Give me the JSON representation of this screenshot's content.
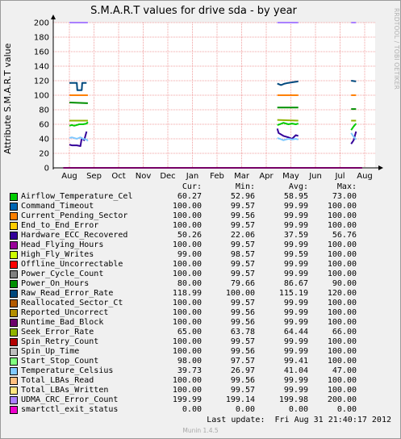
{
  "chart_data": {
    "type": "line",
    "title": "S.M.A.R.T values for drive sda - by year",
    "ylabel": "Attribute S.M.A.R.T value",
    "ylim": [
      0,
      200
    ],
    "yticks": [
      0,
      20,
      40,
      60,
      80,
      100,
      120,
      140,
      160,
      180,
      200
    ],
    "xticks": [
      "Aug",
      "Sep",
      "Oct",
      "Nov",
      "Dec",
      "Jan",
      "Feb",
      "Mar",
      "Apr",
      "May",
      "Jun",
      "Jul",
      "Aug"
    ],
    "grid": true,
    "legend_headers": {
      "cur": "Cur:",
      "min": "Min:",
      "avg": "Avg:",
      "max": "Max:"
    },
    "series": [
      {
        "name": "Airflow_Temperature_Cel",
        "color": "#00cc00",
        "cur": "60.27",
        "min": "52.96",
        "avg": "58.95",
        "max": "73.00",
        "values": [
          [
            0.0,
            58
          ],
          [
            0.1,
            59
          ],
          [
            0.2,
            58
          ],
          [
            0.3,
            59
          ],
          [
            0.4,
            60
          ],
          [
            0.55,
            60
          ],
          [
            0.7,
            61
          ],
          [
            0.75,
            63
          ],
          null,
          [
            8.45,
            59
          ],
          [
            8.55,
            60
          ],
          [
            8.7,
            62
          ],
          [
            8.9,
            60
          ],
          [
            9.05,
            61
          ],
          [
            9.2,
            60
          ],
          [
            9.3,
            61
          ],
          null,
          [
            11.45,
            52
          ],
          [
            11.55,
            57
          ],
          [
            11.65,
            61
          ]
        ]
      },
      {
        "name": "Command_Timeout",
        "color": "#0066b3",
        "cur": "100.00",
        "min": "99.57",
        "avg": "99.99",
        "max": "100.00",
        "values": []
      },
      {
        "name": "Current_Pending_Sector",
        "color": "#ff8000",
        "cur": "100.00",
        "min": "99.56",
        "avg": "99.99",
        "max": "100.00",
        "values": [
          [
            0.0,
            100
          ],
          [
            0.75,
            100
          ],
          null,
          [
            8.45,
            100
          ],
          [
            9.3,
            100
          ],
          null,
          [
            11.45,
            100
          ],
          [
            11.65,
            100
          ]
        ]
      },
      {
        "name": "End_to_End_Error",
        "color": "#ffcc00",
        "cur": "100.00",
        "min": "99.57",
        "avg": "99.99",
        "max": "100.00",
        "values": []
      },
      {
        "name": "Hardware_ECC_Recovered",
        "color": "#330099",
        "cur": "50.26",
        "min": "22.06",
        "avg": "37.59",
        "max": "56.76",
        "values": [
          [
            0.0,
            32
          ],
          [
            0.1,
            31
          ],
          [
            0.3,
            31
          ],
          [
            0.45,
            30
          ],
          [
            0.5,
            41
          ],
          [
            0.6,
            38
          ],
          [
            0.7,
            50
          ],
          null,
          [
            8.45,
            54
          ],
          [
            8.5,
            48
          ],
          [
            8.7,
            44
          ],
          [
            8.9,
            42
          ],
          [
            9.05,
            40
          ],
          [
            9.2,
            45
          ],
          [
            9.3,
            44
          ],
          null,
          [
            11.45,
            33
          ],
          [
            11.55,
            38
          ],
          [
            11.65,
            50
          ]
        ]
      },
      {
        "name": "Head_Flying_Hours",
        "color": "#990099",
        "cur": "100.00",
        "min": "99.57",
        "avg": "99.99",
        "max": "100.00",
        "values": []
      },
      {
        "name": "High_Fly_Writes",
        "color": "#ccff00",
        "cur": "99.00",
        "min": "98.57",
        "avg": "99.59",
        "max": "100.00",
        "values": []
      },
      {
        "name": "Offline_Uncorrectable",
        "color": "#ff0000",
        "cur": "100.00",
        "min": "99.57",
        "avg": "99.99",
        "max": "100.00",
        "values": []
      },
      {
        "name": "Power_Cycle_Count",
        "color": "#808080",
        "cur": "100.00",
        "min": "99.57",
        "avg": "99.99",
        "max": "100.00",
        "values": []
      },
      {
        "name": "Power_On_Hours",
        "color": "#008f00",
        "cur": "80.00",
        "min": "79.66",
        "avg": "86.67",
        "max": "90.00",
        "values": [
          [
            0.0,
            90
          ],
          [
            0.75,
            89
          ],
          null,
          [
            8.45,
            83
          ],
          [
            9.3,
            83
          ],
          null,
          [
            11.45,
            81
          ],
          [
            11.65,
            81
          ]
        ]
      },
      {
        "name": "Raw_Read_Error_Rate",
        "color": "#00487d",
        "cur": "118.99",
        "min": "100.00",
        "avg": "115.19",
        "max": "120.00",
        "values": [
          [
            0.0,
            117
          ],
          [
            0.3,
            117
          ],
          [
            0.32,
            107
          ],
          [
            0.5,
            107
          ],
          [
            0.52,
            117
          ],
          [
            0.7,
            117
          ],
          null,
          [
            8.45,
            116
          ],
          [
            8.6,
            114
          ],
          [
            8.75,
            116
          ],
          [
            8.9,
            117
          ],
          [
            9.1,
            118
          ],
          [
            9.3,
            119
          ],
          null,
          [
            11.45,
            120
          ],
          [
            11.65,
            119
          ]
        ]
      },
      {
        "name": "Reallocated_Sector_Ct",
        "color": "#b35a00",
        "cur": "100.00",
        "min": "99.57",
        "avg": "99.99",
        "max": "100.00",
        "values": []
      },
      {
        "name": "Reported_Uncorrect",
        "color": "#b38f00",
        "cur": "100.00",
        "min": "99.56",
        "avg": "99.99",
        "max": "100.00",
        "values": []
      },
      {
        "name": "Runtime_Bad_Block",
        "color": "#6b006b",
        "cur": "100.00",
        "min": "99.56",
        "avg": "99.99",
        "max": "100.00",
        "values": []
      },
      {
        "name": "Seek_Error_Rate",
        "color": "#8fb300",
        "cur": "65.00",
        "min": "63.78",
        "avg": "64.44",
        "max": "66.00",
        "values": [
          [
            0.0,
            65
          ],
          [
            0.75,
            65
          ],
          null,
          [
            8.45,
            66
          ],
          [
            9.3,
            65
          ],
          null,
          [
            11.45,
            65
          ],
          [
            11.65,
            65
          ]
        ]
      },
      {
        "name": "Spin_Retry_Count",
        "color": "#b30000",
        "cur": "100.00",
        "min": "99.57",
        "avg": "99.99",
        "max": "100.00",
        "values": []
      },
      {
        "name": "Spin_Up_Time",
        "color": "#bebebe",
        "cur": "100.00",
        "min": "99.56",
        "avg": "99.99",
        "max": "100.00",
        "values": []
      },
      {
        "name": "Start_Stop_Count",
        "color": "#80ff80",
        "cur": "98.00",
        "min": "97.57",
        "avg": "99.41",
        "max": "100.00",
        "values": []
      },
      {
        "name": "Temperature_Celsius",
        "color": "#80c9ff",
        "cur": "39.73",
        "min": "26.97",
        "avg": "41.04",
        "max": "47.00",
        "values": [
          [
            0.0,
            41
          ],
          [
            0.1,
            42
          ],
          [
            0.2,
            41
          ],
          [
            0.3,
            40
          ],
          [
            0.45,
            42
          ],
          [
            0.55,
            40
          ],
          [
            0.7,
            39
          ],
          [
            0.75,
            37
          ],
          null,
          [
            8.45,
            41
          ],
          [
            8.55,
            40
          ],
          [
            8.7,
            38
          ],
          [
            8.9,
            40
          ],
          [
            9.05,
            39
          ],
          [
            9.2,
            40
          ],
          [
            9.3,
            39
          ],
          null,
          [
            11.45,
            48
          ],
          [
            11.55,
            43
          ],
          [
            11.65,
            39
          ]
        ]
      },
      {
        "name": "Total_LBAs_Read",
        "color": "#ffc080",
        "cur": "100.00",
        "min": "99.56",
        "avg": "99.99",
        "max": "100.00",
        "values": []
      },
      {
        "name": "Total_LBAs_Written",
        "color": "#ffe680",
        "cur": "100.00",
        "min": "99.57",
        "avg": "99.99",
        "max": "100.00",
        "values": []
      },
      {
        "name": "UDMA_CRC_Error_Count",
        "color": "#aa80ff",
        "cur": "199.99",
        "min": "199.14",
        "avg": "199.98",
        "max": "200.00",
        "values": [
          [
            0.0,
            200
          ],
          [
            0.75,
            200
          ],
          null,
          [
            8.45,
            200
          ],
          [
            9.3,
            200
          ],
          null,
          [
            11.45,
            200
          ],
          [
            11.65,
            200
          ]
        ]
      },
      {
        "name": "smartctl_exit_status",
        "color": "#ee00cc",
        "cur": "0.00",
        "min": "0.00",
        "avg": "0.00",
        "max": "0.00",
        "values": [
          [
            -0.25,
            0
          ],
          [
            11.9,
            0
          ]
        ]
      }
    ]
  },
  "footer": {
    "last_update_label": "Last update:",
    "last_update_value": "Fri Aug 31 21:40:17 2012",
    "version": "Munin 1.4.5",
    "side_text": "RRDTOOL / TOBI OETIKER"
  }
}
